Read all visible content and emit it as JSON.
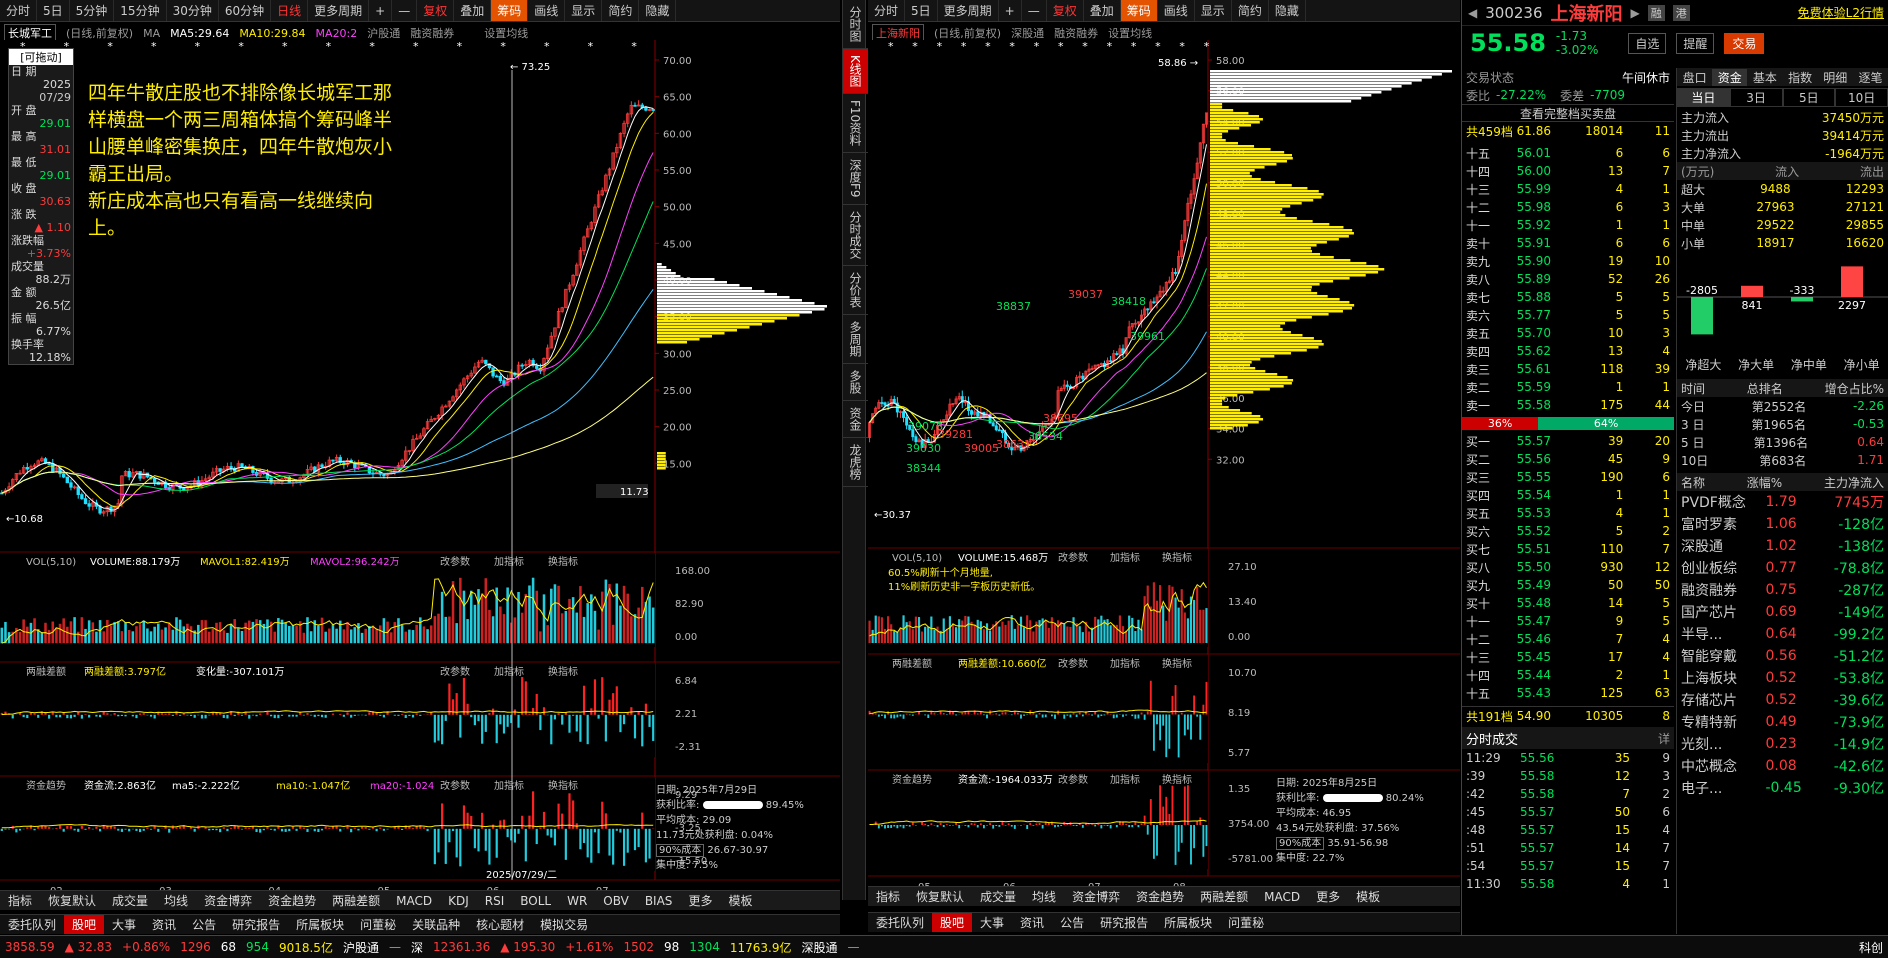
{
  "left": {
    "toolbar": [
      "分时",
      "5日",
      "5分钟",
      "15分钟",
      "30分钟",
      "60分钟",
      "日线",
      "更多周期",
      "+",
      "—",
      "复权",
      "叠加",
      "筹码",
      "画线",
      "显示",
      "简约",
      "隐藏"
    ],
    "name": "长城军工",
    "header": "(日线,前复权)",
    "ma_label": "MA",
    "ma5": "MA5:29.64",
    "ma10": "MA10:29.84",
    "ma20": "MA20:2",
    "hgt": "沪股通",
    "rzrq": "融资融券",
    "set": "设置均线",
    "drag": "[可拖动]",
    "info": [
      [
        "日 期",
        "2025",
        "07/29"
      ],
      [
        "开 盘",
        "29.01",
        ""
      ],
      [
        "最 高",
        "31.01",
        ""
      ],
      [
        "最 低",
        "29.01",
        ""
      ],
      [
        "收 盘",
        "30.63",
        ""
      ],
      [
        "涨 跌",
        "▲ 1.10",
        ""
      ],
      [
        "涨跌幅",
        "+3.73%",
        ""
      ],
      [
        "成交量",
        "88.2万",
        ""
      ],
      [
        "金 额",
        "26.5亿",
        ""
      ],
      [
        "振 幅",
        "6.77%",
        ""
      ],
      [
        "换手率",
        "12.18%",
        ""
      ]
    ],
    "annotation": "四年牛散庄股也不排除像长城军工那样横盘一个两三周箱体搞个筹码峰半山腰单峰密集换庄，四年牛散炮灰小霸王出局。\n新庄成本高也只有看高一线继续向上。",
    "high": "73.25",
    "low": "10.68",
    "cur": "11.73",
    "yaxis": [
      "70.00",
      "65.00",
      "60.00",
      "55.00",
      "50.00",
      "45.00",
      "40.00",
      "35.00",
      "30.00",
      "25.00",
      "20.00",
      "15.00"
    ],
    "vol_hdr": "VOL(5,10)",
    "vol": "VOLUME:88.179万",
    "mavol1": "MAVOL1:82.419万",
    "mavol2": "MAVOL2:96.242万",
    "vol_y": [
      "168.00",
      "82.90",
      "0.00"
    ],
    "rz_hdr": "两融差额",
    "rz": "两融差额:3.797亿",
    "rz2": "变化量:-307.101万",
    "rz_y": [
      "6.84",
      "2.21",
      "-2.31"
    ],
    "zj_hdr": "资金趋势",
    "zj": "资金流:2.863亿",
    "zj_ma5": "ma5:-2.222亿",
    "zj_ma10": "ma10:-1.047亿",
    "zj_ma20": "ma20:-1.024",
    "zj_y": [
      "9.29",
      "-3.25",
      "-15.50"
    ],
    "params": [
      "改参数",
      "加指标",
      "换指标"
    ],
    "xaxis": [
      "02",
      "03",
      "04",
      "05",
      "06",
      "07"
    ],
    "xdate": "2025/07/29/二",
    "chip": {
      "date": "日期: 2025年7月29日",
      "ratio_label": "获利比率:",
      "ratio": "89.45%",
      "avg": "平均成本: 29.09",
      "profit": "11.73元处获利盘: 0.04%",
      "cost": "90%成本",
      "range": "26.67-30.97",
      "conc": "集中度: 7.5%"
    },
    "ind": [
      "指标",
      "恢复默认",
      "成交量",
      "均线",
      "资金博弈",
      "资金趋势",
      "两融差额",
      "MACD",
      "KDJ",
      "RSI",
      "BOLL",
      "WR",
      "OBV",
      "BIAS",
      "更多",
      "模板"
    ],
    "tabs": [
      "委托队列",
      "股吧",
      "大事",
      "资讯",
      "公告",
      "研究报告",
      "所属板块",
      "问董秘",
      "关联品种",
      "核心题材",
      "模拟交易"
    ]
  },
  "right": {
    "toolbar": [
      "分时",
      "5日",
      "更多周期",
      "+",
      "—",
      "复权",
      "叠加",
      "筹码",
      "画线",
      "显示",
      "简约",
      "隐藏"
    ],
    "name": "上海新阳",
    "header": "(日线,前复权)",
    "sgt": "深股通",
    "rzrq": "融资融券",
    "set": "设置均线",
    "high": "58.86",
    "low": "30.37",
    "yaxis": [
      "58.00",
      "56.00",
      "54.00",
      "52.00",
      "50.00",
      "48.00",
      "46.00",
      "44.00",
      "42.00",
      "40.00",
      "38.00",
      "36.00",
      "34.00",
      "32.00"
    ],
    "labels": [
      "38837",
      "39037",
      "38418",
      "39961",
      "39078",
      "39281",
      "39005",
      "38631",
      "38534",
      "38695",
      "39030",
      "38344"
    ],
    "vol_hdr": "VOL(5,10)",
    "vol": "VOLUME:15.468万",
    "vol_y": [
      "27.10",
      "13.40",
      "0.00"
    ],
    "vol_note1": "60.5%刷新十个月地量,",
    "vol_note2": "11%刷新历史非一字板历史新低。",
    "rz_hdr": "两融差额",
    "rz": "两融差额:10.660亿",
    "rz_y": [
      "10.70",
      "8.19",
      "5.77"
    ],
    "zj_hdr": "资金趋势",
    "zj": "资金流:-1964.033万",
    "zj_y": [
      "1.35",
      "3754.00",
      "-5781.00"
    ],
    "xaxis": [
      "05",
      "06",
      "07",
      "08"
    ],
    "chip": {
      "date": "日期: 2025年8月25日",
      "ratio_label": "获利比率:",
      "ratio": "80.24%",
      "avg": "平均成本: 46.95",
      "profit": "43.54元处获利盘: 37.56%",
      "cost": "90%成本",
      "range": "35.91-56.98",
      "conc": "集中度: 22.7%"
    },
    "ind": [
      "指标",
      "恢复默认",
      "成交量",
      "均线",
      "资金博弈",
      "资金趋势",
      "两融差额",
      "MACD",
      "更多",
      "模板"
    ],
    "tabs": [
      "委托队列",
      "股吧",
      "大事",
      "资讯",
      "公告",
      "研究报告",
      "所属板块",
      "问董秘"
    ]
  },
  "vtabs": [
    "分时图",
    "K线图",
    "F10资料",
    "深度F9",
    "分时成交",
    "分价表",
    "多周期",
    "多股",
    "资金",
    "龙虎榜"
  ],
  "quote": {
    "code": "300236",
    "name": "上海新阳",
    "tag1": "融",
    "tag2": "港",
    "trial": "免费体验L2行情",
    "price": "55.58",
    "chg": "-1.73",
    "pct": "-3.02%",
    "btn1": "自选",
    "btn2": "提醒",
    "btn3": "交易",
    "status_l": "交易状态",
    "status_r": "午间休市",
    "wb_l": "委比",
    "wb": "-27.22%",
    "wc_l": "委差",
    "wc": "-7709",
    "full": "查看完整档买卖盘",
    "sell_total": [
      "共459档",
      "61.86",
      "18014",
      "11"
    ],
    "sell": [
      [
        "十五",
        "56.01",
        "6",
        "6"
      ],
      [
        "十四",
        "56.00",
        "13",
        "7"
      ],
      [
        "十三",
        "55.99",
        "4",
        "1"
      ],
      [
        "十二",
        "55.98",
        "6",
        "3"
      ],
      [
        "十一",
        "55.92",
        "1",
        "1"
      ],
      [
        "卖十",
        "55.91",
        "6",
        "6"
      ],
      [
        "卖九",
        "55.90",
        "19",
        "10"
      ],
      [
        "卖八",
        "55.89",
        "52",
        "26"
      ],
      [
        "卖七",
        "55.88",
        "5",
        "5"
      ],
      [
        "卖六",
        "55.77",
        "5",
        "5"
      ],
      [
        "卖五",
        "55.70",
        "10",
        "3"
      ],
      [
        "卖四",
        "55.62",
        "13",
        "4"
      ],
      [
        "卖三",
        "55.61",
        "118",
        "39"
      ],
      [
        "卖二",
        "55.59",
        "1",
        "1"
      ],
      [
        "卖一",
        "55.58",
        "175",
        "44"
      ]
    ],
    "bar_l": "36%",
    "bar_r": "64%",
    "buy": [
      [
        "买一",
        "55.57",
        "39",
        "20"
      ],
      [
        "买二",
        "55.56",
        "45",
        "9"
      ],
      [
        "买三",
        "55.55",
        "190",
        "6"
      ],
      [
        "买四",
        "55.54",
        "1",
        "1"
      ],
      [
        "买五",
        "55.53",
        "4",
        "1"
      ],
      [
        "买六",
        "55.52",
        "5",
        "2"
      ],
      [
        "买七",
        "55.51",
        "110",
        "7"
      ],
      [
        "买八",
        "55.50",
        "930",
        "12"
      ],
      [
        "买九",
        "55.49",
        "50",
        "50"
      ],
      [
        "买十",
        "55.48",
        "14",
        "5"
      ],
      [
        "十一",
        "55.47",
        "9",
        "5"
      ],
      [
        "十二",
        "55.46",
        "7",
        "4"
      ],
      [
        "十三",
        "55.45",
        "17",
        "4"
      ],
      [
        "十四",
        "55.44",
        "2",
        "1"
      ],
      [
        "十五",
        "55.43",
        "125",
        "63"
      ]
    ],
    "buy_total": [
      "共191档",
      "54.90",
      "10305",
      "8"
    ],
    "ticks_title": "分时成交",
    "ticks_more": "详",
    "ticks": [
      [
        "11:29",
        "55.56",
        "35",
        "9"
      ],
      [
        ":39",
        "55.58",
        "12",
        "3"
      ],
      [
        ":42",
        "55.58",
        "7",
        "2"
      ],
      [
        ":45",
        "55.57",
        "50",
        "6"
      ],
      [
        ":48",
        "55.57",
        "15",
        "4"
      ],
      [
        ":51",
        "55.57",
        "14",
        "7"
      ],
      [
        ":54",
        "55.57",
        "15",
        "7"
      ],
      [
        "11:30",
        "55.58",
        "4",
        "1"
      ]
    ]
  },
  "fund": {
    "tabs": [
      "盘口",
      "资金",
      "基本",
      "指数",
      "明细",
      "逐笔"
    ],
    "periods": [
      "当日",
      "3日",
      "5日",
      "10日"
    ],
    "flow": [
      [
        "主力流入",
        "37450万元"
      ],
      [
        "主力流出",
        "39414万元"
      ],
      [
        "主力净流入",
        "-1964万元"
      ]
    ],
    "unit": "(万元)",
    "in": "流入",
    "out": "流出",
    "tbl": [
      [
        "超大",
        "9488",
        "12293"
      ],
      [
        "大单",
        "27963",
        "27121"
      ],
      [
        "中单",
        "29522",
        "29855"
      ],
      [
        "小单",
        "18917",
        "16620"
      ]
    ],
    "bars": [
      "-2805",
      "841",
      "-333",
      "2297"
    ],
    "bar_names": [
      "净超大",
      "净大单",
      "净中单",
      "净小单"
    ],
    "rank_h": [
      "时间",
      "总排名",
      "增仓占比%"
    ],
    "rank": [
      [
        "今日",
        "第2552名",
        "-2.26"
      ],
      [
        "3 日",
        "第1965名",
        "-0.53"
      ],
      [
        "5 日",
        "第1396名",
        "0.64"
      ],
      [
        "10日",
        "第683名",
        "1.71"
      ]
    ],
    "blk_h": [
      "名称",
      "涨幅%",
      "主力净流入"
    ],
    "blocks": [
      [
        "PVDF概念",
        "1.79",
        "7745万"
      ],
      [
        "富时罗素",
        "1.06",
        "-128亿"
      ],
      [
        "深股通",
        "1.02",
        "-138亿"
      ],
      [
        "创业板综",
        "0.77",
        "-78.8亿"
      ],
      [
        "融资融券",
        "0.75",
        "-287亿"
      ],
      [
        "国产芯片",
        "0.69",
        "-149亿"
      ],
      [
        "半导...",
        "0.64",
        "-99.2亿"
      ],
      [
        "智能穿戴",
        "0.56",
        "-51.2亿"
      ],
      [
        "上海板块",
        "0.52",
        "-53.8亿"
      ],
      [
        "存储芯片",
        "0.52",
        "-39.6亿"
      ],
      [
        "专精特新",
        "0.49",
        "-73.9亿"
      ],
      [
        "光刻...",
        "0.23",
        "-14.9亿"
      ],
      [
        "中芯概念",
        "0.08",
        "-42.6亿"
      ],
      [
        "电子...",
        "-0.45",
        "-9.30亿"
      ]
    ]
  },
  "status": {
    "sh": "3858.59",
    "sh_chg": "▲ 32.83",
    "sh_pct": "+0.86%",
    "n1": "1296",
    "n2": "68",
    "n3": "954",
    "sh_amt": "9018.5亿",
    "hgt": "沪股通",
    "sz_l": "深",
    "sz": "12361.36",
    "sz_chg": "▲ 195.30",
    "sz_pct": "+1.61%",
    "n4": "1502",
    "n5": "98",
    "n6": "1304",
    "sz_amt": "11763.9亿",
    "sgt": "深股通",
    "last": "科创"
  }
}
